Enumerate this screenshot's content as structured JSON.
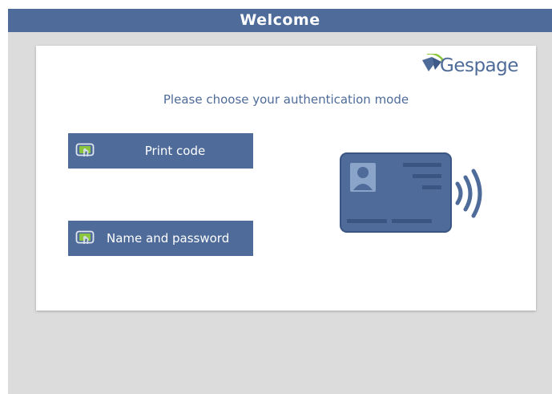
{
  "window": {
    "title": "Welcome"
  },
  "brand": {
    "name": "Gespage",
    "primary_color": "#4e6b9a",
    "accent_color": "#8cc63f"
  },
  "auth": {
    "prompt": "Please choose your authentication mode",
    "options": [
      {
        "label": "Print code",
        "icon": "touch-screen-icon"
      },
      {
        "label": "Name and password",
        "icon": "touch-screen-icon"
      }
    ],
    "illustration": "contactless-card-icon"
  }
}
